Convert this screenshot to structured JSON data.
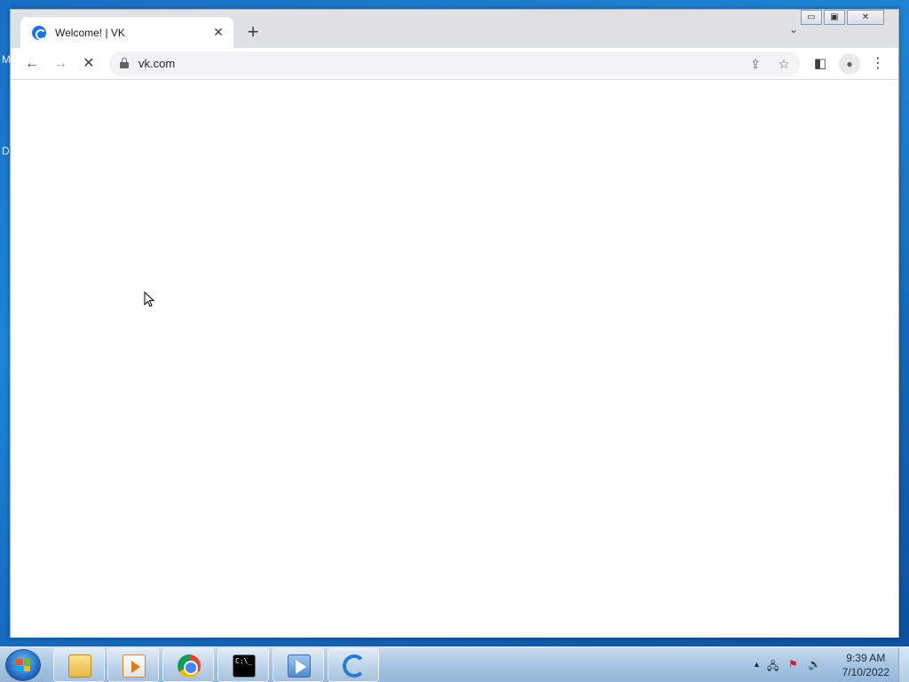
{
  "desktop": {
    "left_labels": [
      "M",
      "D"
    ]
  },
  "browser": {
    "tab": {
      "title": "Welcome! | VK",
      "close_glyph": "✕",
      "favicon": "vk-icon"
    },
    "new_tab_glyph": "+",
    "tab_search_glyph": "⌄",
    "window_buttons": {
      "minimize": "▭",
      "restore": "▣",
      "close": "✕"
    },
    "toolbar": {
      "back_glyph": "←",
      "forward_glyph": "→",
      "stop_glyph": "✕",
      "url": "vk.com",
      "share_glyph": "⇪",
      "bookmark_glyph": "☆",
      "sidepanel_glyph": "◧",
      "profile_glyph": "●",
      "menu_glyph": "⋮"
    }
  },
  "taskbar": {
    "apps": [
      "windows-explorer",
      "media-player",
      "chrome",
      "command-prompt",
      "video-player",
      "app-g"
    ],
    "tray": {
      "up_arrow": "▲",
      "network": "🖧",
      "flag": "⚑",
      "volume": "🔊"
    },
    "clock": {
      "time": "9:39 AM",
      "date": "7/10/2022"
    }
  },
  "colors": {
    "accent": "#1a73e8",
    "taskbar": "#a7c4e2",
    "desktop": "#1f86d6"
  }
}
